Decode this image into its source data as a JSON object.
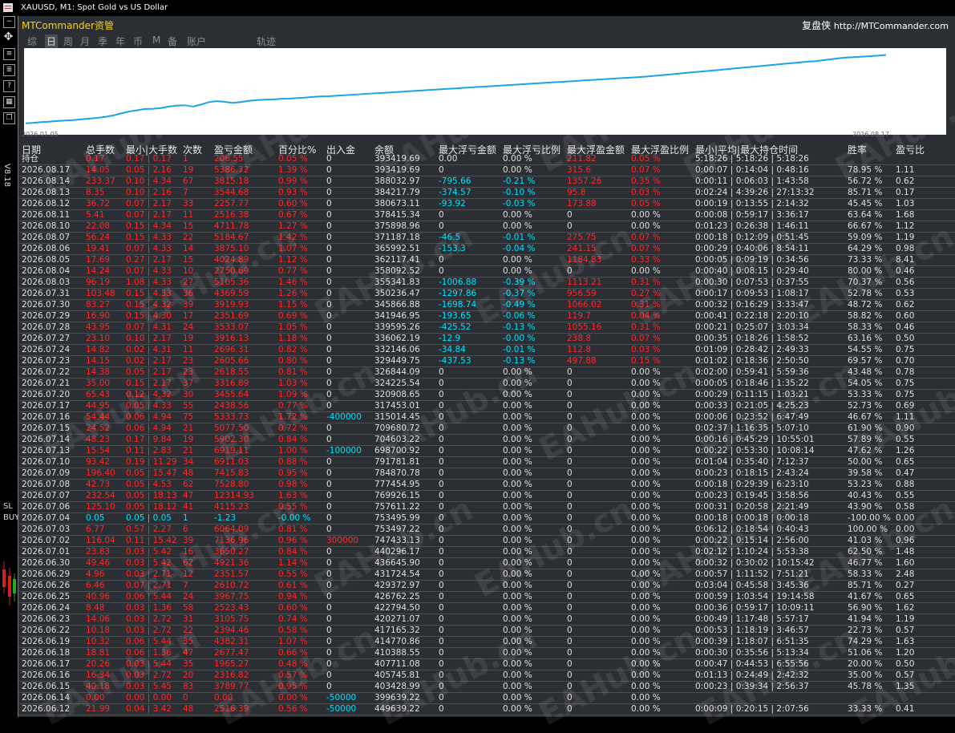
{
  "window": {
    "title": "XAUUSD, M1:  Spot Gold vs US Dollar"
  },
  "sidebar": {
    "version": "V8.18",
    "sl": "SL",
    "buy": "BUY"
  },
  "brand": {
    "name": "MTCommander资管",
    "right_name": "复盘侠",
    "url": "http://MTCommander.com"
  },
  "tabs": [
    {
      "label": "综",
      "active": false
    },
    {
      "label": "日",
      "active": true
    },
    {
      "label": "周",
      "active": false
    },
    {
      "label": "月",
      "active": false
    },
    {
      "label": "季",
      "active": false
    },
    {
      "label": "年",
      "active": false
    },
    {
      "label": "币",
      "active": false
    },
    {
      "label": "M",
      "active": false
    },
    {
      "label": "备",
      "active": false
    },
    {
      "label": "账户",
      "active": false
    },
    {
      "label": "轨迹",
      "active": false
    }
  ],
  "chart_data": {
    "type": "line",
    "x_start_label": "2026.01.05",
    "x_end_label": "2026.08.17",
    "line_color": "#1aa3e6",
    "y": [
      257000,
      258000,
      259500,
      260500,
      261500,
      262500,
      263500,
      265000,
      266500,
      268000,
      270000,
      273000,
      277000,
      281000,
      283500,
      286000,
      286500,
      288000,
      291000,
      293000,
      293500,
      291000,
      295000,
      300000,
      302000,
      300500,
      298500,
      300000,
      302500,
      304000,
      305000,
      305500,
      306500,
      307000,
      308000,
      309000,
      310500,
      311500,
      312000,
      313000,
      314000,
      315000,
      316000,
      317000,
      318000,
      319000,
      320000,
      321000,
      322000,
      323000,
      324000,
      325000,
      326000,
      327000,
      328000,
      329000,
      330000,
      331000,
      332000,
      333000,
      334000,
      335000,
      336000,
      337000,
      338000,
      339000,
      340000,
      341000,
      342000,
      343000,
      344000,
      345000,
      346000,
      347000,
      348000,
      349000,
      350000,
      351000,
      352000,
      353500,
      355000,
      356500,
      358000,
      359500,
      361000,
      362500,
      364000,
      365500,
      367000,
      368500,
      370000,
      371500,
      373000,
      374500,
      376000,
      377500,
      379000,
      380500,
      382000,
      383000,
      385000,
      387000,
      389000,
      390500,
      391500,
      392500,
      393500,
      394500,
      396000
    ]
  },
  "table": {
    "columns": [
      "日期",
      "总手数",
      "最小|大手数",
      "次数",
      "盈亏金额",
      "百分比%",
      "出入金",
      "余额",
      "最大浮亏金额",
      "最大浮亏比例",
      "最大浮盈金额",
      "最大浮盈比例",
      "最小|平均|最大持仓时间",
      "胜率",
      "盈亏比"
    ],
    "rows": [
      [
        "持仓",
        "0.17",
        "0.17 | 0.17",
        "1",
        "206.55",
        "0.05 %",
        "0",
        "393419.69",
        "0.00",
        "0.00 %",
        "211.82",
        "0.05 %",
        "5:18:26 | 5:18:26 | 5:18:26",
        "",
        ""
      ],
      [
        "2026.08.17",
        "14.05",
        "0.05 | 2.16",
        "19",
        "5386.72",
        "1.39 %",
        "0",
        "393419.69",
        "0",
        "0.00 %",
        "315.6",
        "0.07 %",
        "0:00:07 | 0:14:04 | 0:48:16",
        "78.95 %",
        "1.11"
      ],
      [
        "2026.08.14",
        "233.37",
        "0.10 | 4.34",
        "67",
        "3815.18",
        "0.99 %",
        "0",
        "388032.97",
        "-795.66",
        "-0.21 %",
        "1357.26",
        "0.35 %",
        "0:00:11 | 0:06:03 | 1:43:58",
        "56.72 %",
        "0.62"
      ],
      [
        "2026.08.13",
        "8.35",
        "0.10 | 2.16",
        "7",
        "3544.68",
        "0.93 %",
        "0",
        "384217.79",
        "-374.57",
        "-0.10 %",
        "95.8",
        "0.03 %",
        "0:02:24 | 4:39:26 | 27:13:32",
        "85.71 %",
        "0.17"
      ],
      [
        "2026.08.12",
        "36.72",
        "0.07 | 2.17",
        "33",
        "2257.77",
        "0.60 %",
        "0",
        "380673.11",
        "-93.92",
        "-0.03 %",
        "173.88",
        "0.05 %",
        "0:00:19 | 0:13:55 | 2:14:32",
        "45.45 %",
        "1.03"
      ],
      [
        "2026.08.11",
        "5.41",
        "0.07 | 2.17",
        "11",
        "2516.38",
        "0.67 %",
        "0",
        "378415.34",
        "0",
        "0.00 %",
        "0",
        "0.00 %",
        "0:00:08 | 0:59:17 | 3:36:17",
        "63.64 %",
        "1.68"
      ],
      [
        "2026.08.10",
        "22.08",
        "0.15 | 4.34",
        "15",
        "4711.78",
        "1.27 %",
        "0",
        "375898.96",
        "0",
        "0.00 %",
        "0",
        "0.00 %",
        "0:01:23 | 0:26:38 | 1:46:11",
        "66.67 %",
        "1.12"
      ],
      [
        "2026.08.07",
        "56.24",
        "0.15 | 4.33",
        "22",
        "5184.67",
        "1.42 %",
        "0",
        "371187.18",
        "-46.5",
        "-0.01 %",
        "275.75",
        "0.07 %",
        "0:00:18 | 0:12:09 | 0:51:45",
        "59.09 %",
        "1.19"
      ],
      [
        "2026.08.06",
        "19.41",
        "0.07 | 4.33",
        "14",
        "3875.10",
        "1.07 %",
        "0",
        "365992.51",
        "-153.3",
        "-0.04 %",
        "241.15",
        "0.07 %",
        "0:00:29 | 0:40:06 | 8:54:11",
        "64.29 %",
        "0.98"
      ],
      [
        "2026.08.05",
        "17.69",
        "0.27 | 2.17",
        "15",
        "4024.89",
        "1.12 %",
        "0",
        "362117.41",
        "0",
        "0.00 %",
        "1184.83",
        "0.33 %",
        "0:00:05 | 0:09:19 | 0:34:56",
        "73.33 %",
        "8.41"
      ],
      [
        "2026.08.04",
        "14.24",
        "0.07 | 4.33",
        "10",
        "2750.69",
        "0.77 %",
        "0",
        "358092.52",
        "0",
        "0.00 %",
        "0",
        "0.00 %",
        "0:00:40 | 0:08:15 | 0:29:40",
        "80.00 %",
        "0.46"
      ],
      [
        "2026.08.03",
        "96.19",
        "1.08 | 4.33",
        "27",
        "5105.36",
        "1.46 %",
        "0",
        "355341.83",
        "-1006.88",
        "-0.39 %",
        "1113.21",
        "0.31 %",
        "0:00:30 | 0:07:53 | 0:37:55",
        "70.37 %",
        "0.56"
      ],
      [
        "2026.07.31",
        "103.48",
        "0.15 | 4.33",
        "36",
        "4369.59",
        "1.26 %",
        "0",
        "350236.47",
        "-1297.86",
        "-0.37 %",
        "956.59",
        "0.27 %",
        "0:00:17 | 0:09:53 | 1:08:17",
        "52.78 %",
        "0.53"
      ],
      [
        "2026.07.30",
        "83.27",
        "0.15 | 4.32",
        "39",
        "3919.93",
        "1.15 %",
        "0",
        "345866.88",
        "-1698.74",
        "-0.49 %",
        "1066.02",
        "0.31 %",
        "0:00:32 | 0:16:29 | 3:33:47",
        "48.72 %",
        "0.62"
      ],
      [
        "2026.07.29",
        "16.90",
        "0.15 | 4.30",
        "17",
        "2351.69",
        "0.69 %",
        "0",
        "341946.95",
        "-193.65",
        "-0.06 %",
        "119.7",
        "0.04 %",
        "0:00:41 | 0:22:18 | 2:20:10",
        "58.82 %",
        "0.60"
      ],
      [
        "2026.07.28",
        "43.95",
        "0.07 | 4.31",
        "24",
        "3533.07",
        "1.05 %",
        "0",
        "339595.26",
        "-425.52",
        "-0.13 %",
        "1055.16",
        "0.31 %",
        "0:00:21 | 0:25:07 | 3:03:34",
        "58.33 %",
        "0.46"
      ],
      [
        "2026.07.27",
        "23.10",
        "0.10 | 2.17",
        "19",
        "3916.13",
        "1.18 %",
        "0",
        "336062.19",
        "-12.9",
        "-0.00 %",
        "238.8",
        "0.07 %",
        "0:00:35 | 0:18:26 | 1:58:52",
        "63.16 %",
        "0.50"
      ],
      [
        "2026.07.24",
        "14.82",
        "0.02 | 4.31",
        "11",
        "2696.31",
        "0.82 %",
        "0",
        "332146.06",
        "-34.84",
        "-0.01 %",
        "112.8",
        "0.03 %",
        "0:01:09 | 0:28:42 | 2:49:33",
        "54.55 %",
        "0.75"
      ],
      [
        "2026.07.23",
        "14.15",
        "0.02 | 2.17",
        "23",
        "2605.66",
        "0.80 %",
        "0",
        "329449.75",
        "-437.53",
        "-0.13 %",
        "497.88",
        "0.15 %",
        "0:01:02 | 0:18:36 | 2:50:50",
        "69.57 %",
        "0.70"
      ],
      [
        "2026.07.22",
        "14.38",
        "0.05 | 2.17",
        "23",
        "2618.55",
        "0.81 %",
        "0",
        "326844.09",
        "0",
        "0.00 %",
        "0",
        "0.00 %",
        "0:02:00 | 0:59:41 | 5:59:36",
        "43.48 %",
        "0.78"
      ],
      [
        "2026.07.21",
        "35.00",
        "0.15 | 2.17",
        "37",
        "3316.89",
        "1.03 %",
        "0",
        "324225.54",
        "0",
        "0.00 %",
        "0",
        "0.00 %",
        "0:00:05 | 0:18:46 | 1:35:22",
        "54.05 %",
        "0.75"
      ],
      [
        "2026.07.20",
        "65.43",
        "0.12 | 4.32",
        "30",
        "3455.64",
        "1.09 %",
        "0",
        "320908.65",
        "0",
        "0.00 %",
        "0",
        "0.00 %",
        "0:00:29 | 0:11:15 | 1:03:21",
        "53.33 %",
        "0.75"
      ],
      [
        "2026.07.17",
        "44.95",
        "0.05 | 4.33",
        "55",
        "2438.56",
        "0.77 %",
        "0",
        "317453.01",
        "0",
        "0.00 %",
        "0",
        "0.00 %",
        "0:00:33 | 0:21:05 | 4:25:23",
        "52.73 %",
        "0.69"
      ],
      [
        "2026.07.16",
        "54.44",
        "0.06 | 4.94",
        "75",
        "5333.73",
        "1.72 %",
        "-400000",
        "315014.45",
        "0",
        "0.00 %",
        "0",
        "0.00 %",
        "0:00:06 | 0:23:52 | 6:47:49",
        "46.67 %",
        "1.11"
      ],
      [
        "2026.07.15",
        "24.52",
        "0.06 | 4.94",
        "21",
        "5077.50",
        "0.72 %",
        "0",
        "709680.72",
        "0",
        "0.00 %",
        "0",
        "0.00 %",
        "0:02:37 | 1:16:35 | 5:07:10",
        "61.90 %",
        "0.90"
      ],
      [
        "2026.07.14",
        "48.23",
        "0.17 | 9.84",
        "19",
        "5902.30",
        "0.84 %",
        "0",
        "704603.22",
        "0",
        "0.00 %",
        "0",
        "0.00 %",
        "0:00:16 | 0:45:29 | 10:55:01",
        "57.89 %",
        "0.55"
      ],
      [
        "2026.07.13",
        "15.54",
        "0.11 | 2.83",
        "21",
        "6919.11",
        "1.00 %",
        "-100000",
        "698700.92",
        "0",
        "0.00 %",
        "0",
        "0.00 %",
        "0:00:22 | 0:53:30 | 10:08:14",
        "47.62 %",
        "1.26"
      ],
      [
        "2026.07.10",
        "93.42",
        "0.19 | 11.29",
        "34",
        "6911.03",
        "0.88 %",
        "0",
        "791781.81",
        "0",
        "0.00 %",
        "0",
        "0.00 %",
        "0:01:04 | 0:35:40 | 7:12:37",
        "50.00 %",
        "0.65"
      ],
      [
        "2026.07.09",
        "196.40",
        "0.05 | 15.47",
        "48",
        "7415.83",
        "0.95 %",
        "0",
        "784870.78",
        "0",
        "0.00 %",
        "0",
        "0.00 %",
        "0:00:23 | 0:18:15 | 2:43:24",
        "39.58 %",
        "0.47"
      ],
      [
        "2026.07.08",
        "42.73",
        "0.05 | 4.53",
        "62",
        "7528.80",
        "0.98 %",
        "0",
        "777454.95",
        "0",
        "0.00 %",
        "0",
        "0.00 %",
        "0:00:18 | 0:29:39 | 6:23:10",
        "53.23 %",
        "0.88"
      ],
      [
        "2026.07.07",
        "232.54",
        "0.05 | 18.13",
        "47",
        "12314.93",
        "1.63 %",
        "0",
        "769926.15",
        "0",
        "0.00 %",
        "0",
        "0.00 %",
        "0:00:23 | 0:19:45 | 3:58:56",
        "40.43 %",
        "0.55"
      ],
      [
        "2026.07.06",
        "125.10",
        "0.05 | 18.12",
        "41",
        "4115.23",
        "0.55 %",
        "0",
        "757611.22",
        "0",
        "0.00 %",
        "0",
        "0.00 %",
        "0:00:31 | 0:20:58 | 2:21:49",
        "43.90 %",
        "0.58"
      ],
      [
        "2026.07.04",
        "0.05",
        "0.05 | 0.05",
        "1",
        "-1.23",
        "-0.00 %",
        "0",
        "753495.99",
        "0",
        "0.00 %",
        "0",
        "0.00 %",
        "0:00:18 | 0:00:18 | 0:00:18",
        "-100.00 %",
        "0.00"
      ],
      [
        "2026.07.03",
        "6.77",
        "0.57 | 2.27",
        "6",
        "6064.09",
        "0.81 %",
        "0",
        "753497.22",
        "0",
        "0.00 %",
        "0",
        "0.00 %",
        "0:06:12 | 0:18:54 | 0:40:43",
        "100.00 %",
        "0.00"
      ],
      [
        "2026.07.02",
        "116.04",
        "0.11 | 15.42",
        "39",
        "7136.96",
        "0.96 %",
        "300000",
        "747433.13",
        "0",
        "0.00 %",
        "0",
        "0.00 %",
        "0:00:22 | 0:15:14 | 2:56:00",
        "41.03 %",
        "0.96"
      ],
      [
        "2026.07.01",
        "23.83",
        "0.03 | 5.42",
        "16",
        "3650.27",
        "0.84 %",
        "0",
        "440296.17",
        "0",
        "0.00 %",
        "0",
        "0.00 %",
        "0:02:12 | 1:10:24 | 5:53:38",
        "62.50 %",
        "1.48"
      ],
      [
        "2026.06.30",
        "49.46",
        "0.03 | 5.42",
        "62",
        "4921.36",
        "1.14 %",
        "0",
        "436645.90",
        "0",
        "0.00 %",
        "0",
        "0.00 %",
        "0:00:32 | 0:30:02 | 10:15:42",
        "46.77 %",
        "1.60"
      ],
      [
        "2026.06.29",
        "4.96",
        "0.03 | 2.71",
        "12",
        "2351.57",
        "0.55 %",
        "0",
        "431724.54",
        "0",
        "0.00 %",
        "0",
        "0.00 %",
        "0:00:57 | 1:11:52 | 7:51:21",
        "58.33 %",
        "2.48"
      ],
      [
        "2026.06.26",
        "6.46",
        "0.07 | 2.71",
        "7",
        "2610.72",
        "0.61 %",
        "0",
        "429372.97",
        "0",
        "0.00 %",
        "0",
        "0.00 %",
        "0:03:04 | 0:45:58 | 3:45:36",
        "85.71 %",
        "0.27"
      ],
      [
        "2026.06.25",
        "40.96",
        "0.06 | 5.44",
        "24",
        "3967.75",
        "0.94 %",
        "0",
        "426762.25",
        "0",
        "0.00 %",
        "0",
        "0.00 %",
        "0:00:59 | 1:03:54 | 19:14:58",
        "41.67 %",
        "0.65"
      ],
      [
        "2026.06.24",
        "8.48",
        "0.03 | 1.36",
        "58",
        "2523.43",
        "0.60 %",
        "0",
        "422794.50",
        "0",
        "0.00 %",
        "0",
        "0.00 %",
        "0:00:36 | 0:59:17 | 10:09:11",
        "56.90 %",
        "1.62"
      ],
      [
        "2026.06.23",
        "14.06",
        "0.03 | 2.72",
        "31",
        "3105.75",
        "0.74 %",
        "0",
        "420271.07",
        "0",
        "0.00 %",
        "0",
        "0.00 %",
        "0:00:49 | 1:17:48 | 5:57:17",
        "41.94 %",
        "1.19"
      ],
      [
        "2026.06.22",
        "10.18",
        "0.03 | 2.72",
        "22",
        "2394.46",
        "0.58 %",
        "0",
        "417165.32",
        "0",
        "0.00 %",
        "0",
        "0.00 %",
        "0:00:53 | 1:18:19 | 3:46:57",
        "22.73 %",
        "0.57"
      ],
      [
        "2026.06.19",
        "10.32",
        "0.06 | 5.44",
        "35",
        "4382.31",
        "1.07 %",
        "0",
        "414770.86",
        "0",
        "0.00 %",
        "0",
        "0.00 %",
        "0:00:39 | 1:18:07 | 6:51:35",
        "74.29 %",
        "1.63"
      ],
      [
        "2026.06.18",
        "18.81",
        "0.06 | 1.36",
        "47",
        "2677.47",
        "0.66 %",
        "0",
        "410388.55",
        "0",
        "0.00 %",
        "0",
        "0.00 %",
        "0:00:30 | 0:35:56 | 5:13:34",
        "51.06 %",
        "1.20"
      ],
      [
        "2026.06.17",
        "20.26",
        "0.03 | 5.44",
        "35",
        "1965.27",
        "0.48 %",
        "0",
        "407711.08",
        "0",
        "0.00 %",
        "0",
        "0.00 %",
        "0:00:47 | 0:44:53 | 6:55:56",
        "20.00 %",
        "0.50"
      ],
      [
        "2026.06.16",
        "16.34",
        "0.03 | 2.72",
        "20",
        "2316.82",
        "0.57 %",
        "0",
        "405745.81",
        "0",
        "0.00 %",
        "0",
        "0.00 %",
        "0:01:13 | 0:24:49 | 2:42:32",
        "35.00 %",
        "0.57"
      ],
      [
        "2026.06.15",
        "40.18",
        "0.03 | 5.45",
        "83",
        "3789.77",
        "0.95 %",
        "0",
        "403428.99",
        "0",
        "0.00 %",
        "0",
        "0.00 %",
        "0:00:23 | 0:39:34 | 2:56:37",
        "45.78 %",
        "1.35"
      ],
      [
        "2026.06.14",
        "0.00",
        "0.00 | 0.00",
        "0",
        "0.00",
        "0.00 %",
        "-50000",
        "399639.22",
        "0",
        "0.00 %",
        "0",
        "0.00 %",
        "",
        "",
        ""
      ],
      [
        "2026.06.12",
        "21.99",
        "0.04 | 3.42",
        "48",
        "2516.39",
        "0.56 %",
        "-50000",
        "449639.22",
        "0",
        "0.00 %",
        "0",
        "0.00 %",
        "0:00:09 | 0:20:15 | 2:07:56",
        "33.33 %",
        "0.41"
      ]
    ]
  },
  "watermark": "EAHub.cn"
}
